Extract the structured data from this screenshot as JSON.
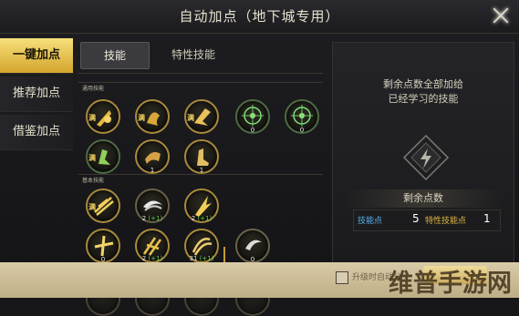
{
  "header": {
    "title": "自动加点（地下城专用）"
  },
  "sidebar": {
    "items": [
      {
        "label": "一键加点",
        "active": true
      },
      {
        "label": "推荐加点",
        "active": false
      },
      {
        "label": "借鉴加点",
        "active": false
      }
    ]
  },
  "tabs": [
    {
      "label": "技能",
      "active": true
    },
    {
      "label": "特性技能",
      "active": false
    }
  ],
  "sections": {
    "general": "通用技能",
    "basic": "基本技能",
    "level5": "5"
  },
  "skills": {
    "general": [
      {
        "level": "满"
      },
      {
        "level": "满"
      },
      {
        "level": "满"
      },
      {
        "level": "0"
      },
      {
        "level": "0"
      },
      {
        "level": "满"
      },
      {
        "level": "1"
      },
      {
        "level": "1"
      }
    ],
    "basic": [
      {
        "level": "满"
      },
      {
        "level": "2",
        "bonus": "(+1)"
      },
      {
        "level": "2",
        "bonus": "(+1)"
      },
      {
        "level": "0"
      },
      {
        "level": "2",
        "bonus": "(+1)"
      },
      {
        "level": "31",
        "bonus": "(+1)"
      },
      {
        "level": "0"
      }
    ]
  },
  "right": {
    "message_line1": "剩余点数全部加给",
    "message_line2": "已经学习的技能",
    "points_title": "剩余点数",
    "skill_points_label": "技能点",
    "skill_points_value": "5",
    "trait_points_label": "特性技能点",
    "trait_points_value": "1"
  },
  "bottom": {
    "checkbox_label": "升级时自动分"
  },
  "watermark": "维普手游网",
  "colors": {
    "accent_gold": "#d4a52c",
    "skill_points_blue": "#57b0e6",
    "trait_points_gold": "#e0b640"
  }
}
